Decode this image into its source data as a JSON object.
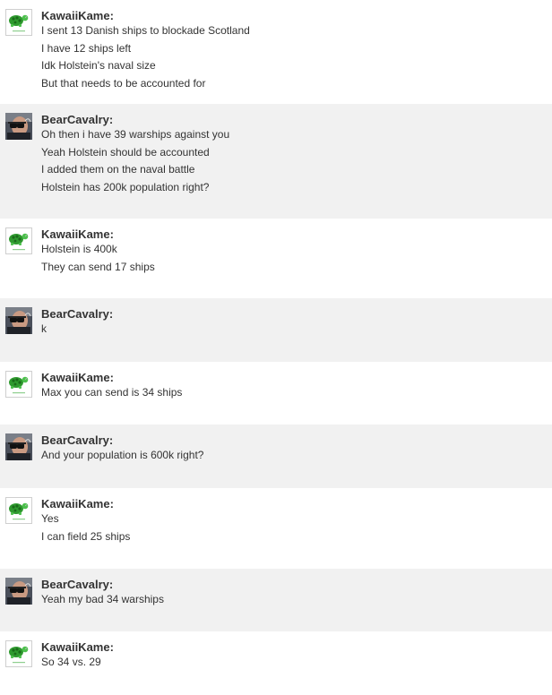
{
  "messages": [
    {
      "author": "KawaiiKame:",
      "avatar_icon": "green-turtle-icon",
      "lines": [
        "I sent 13 Danish ships to blockade Scotland",
        "I have 12 ships left",
        "Idk Holstein's naval size",
        "But that needs to be accounted for"
      ]
    },
    {
      "author": "BearCavalry:",
      "avatar_icon": "man-with-binoculars-icon",
      "lines": [
        "Oh then i have 39 warships against you",
        "Yeah Holstein should be accounted",
        "I added them on the naval battle",
        "Holstein has 200k population right?"
      ]
    },
    {
      "author": "KawaiiKame:",
      "avatar_icon": "green-turtle-icon",
      "lines": [
        "Holstein is 400k",
        "They can send 17 ships"
      ]
    },
    {
      "author": "BearCavalry:",
      "avatar_icon": "man-with-binoculars-icon",
      "lines": [
        "k"
      ]
    },
    {
      "author": "KawaiiKame:",
      "avatar_icon": "green-turtle-icon",
      "lines": [
        "Max you can send is 34 ships"
      ]
    },
    {
      "author": "BearCavalry:",
      "avatar_icon": "man-with-binoculars-icon",
      "lines": [
        "And your population is 600k right?"
      ]
    },
    {
      "author": "KawaiiKame:",
      "avatar_icon": "green-turtle-icon",
      "lines": [
        "Yes",
        "I can field 25 ships"
      ]
    },
    {
      "author": "BearCavalry:",
      "avatar_icon": "man-with-binoculars-icon",
      "lines": [
        "Yeah my bad 34 warships"
      ]
    },
    {
      "author": "KawaiiKame:",
      "avatar_icon": "green-turtle-icon",
      "lines": [
        "So 34 vs. 29"
      ]
    }
  ],
  "colors": {
    "row_white": "#ffffff",
    "row_grey": "#f1f1f1",
    "text": "#333333",
    "turtle_green": "#3aa63a"
  }
}
